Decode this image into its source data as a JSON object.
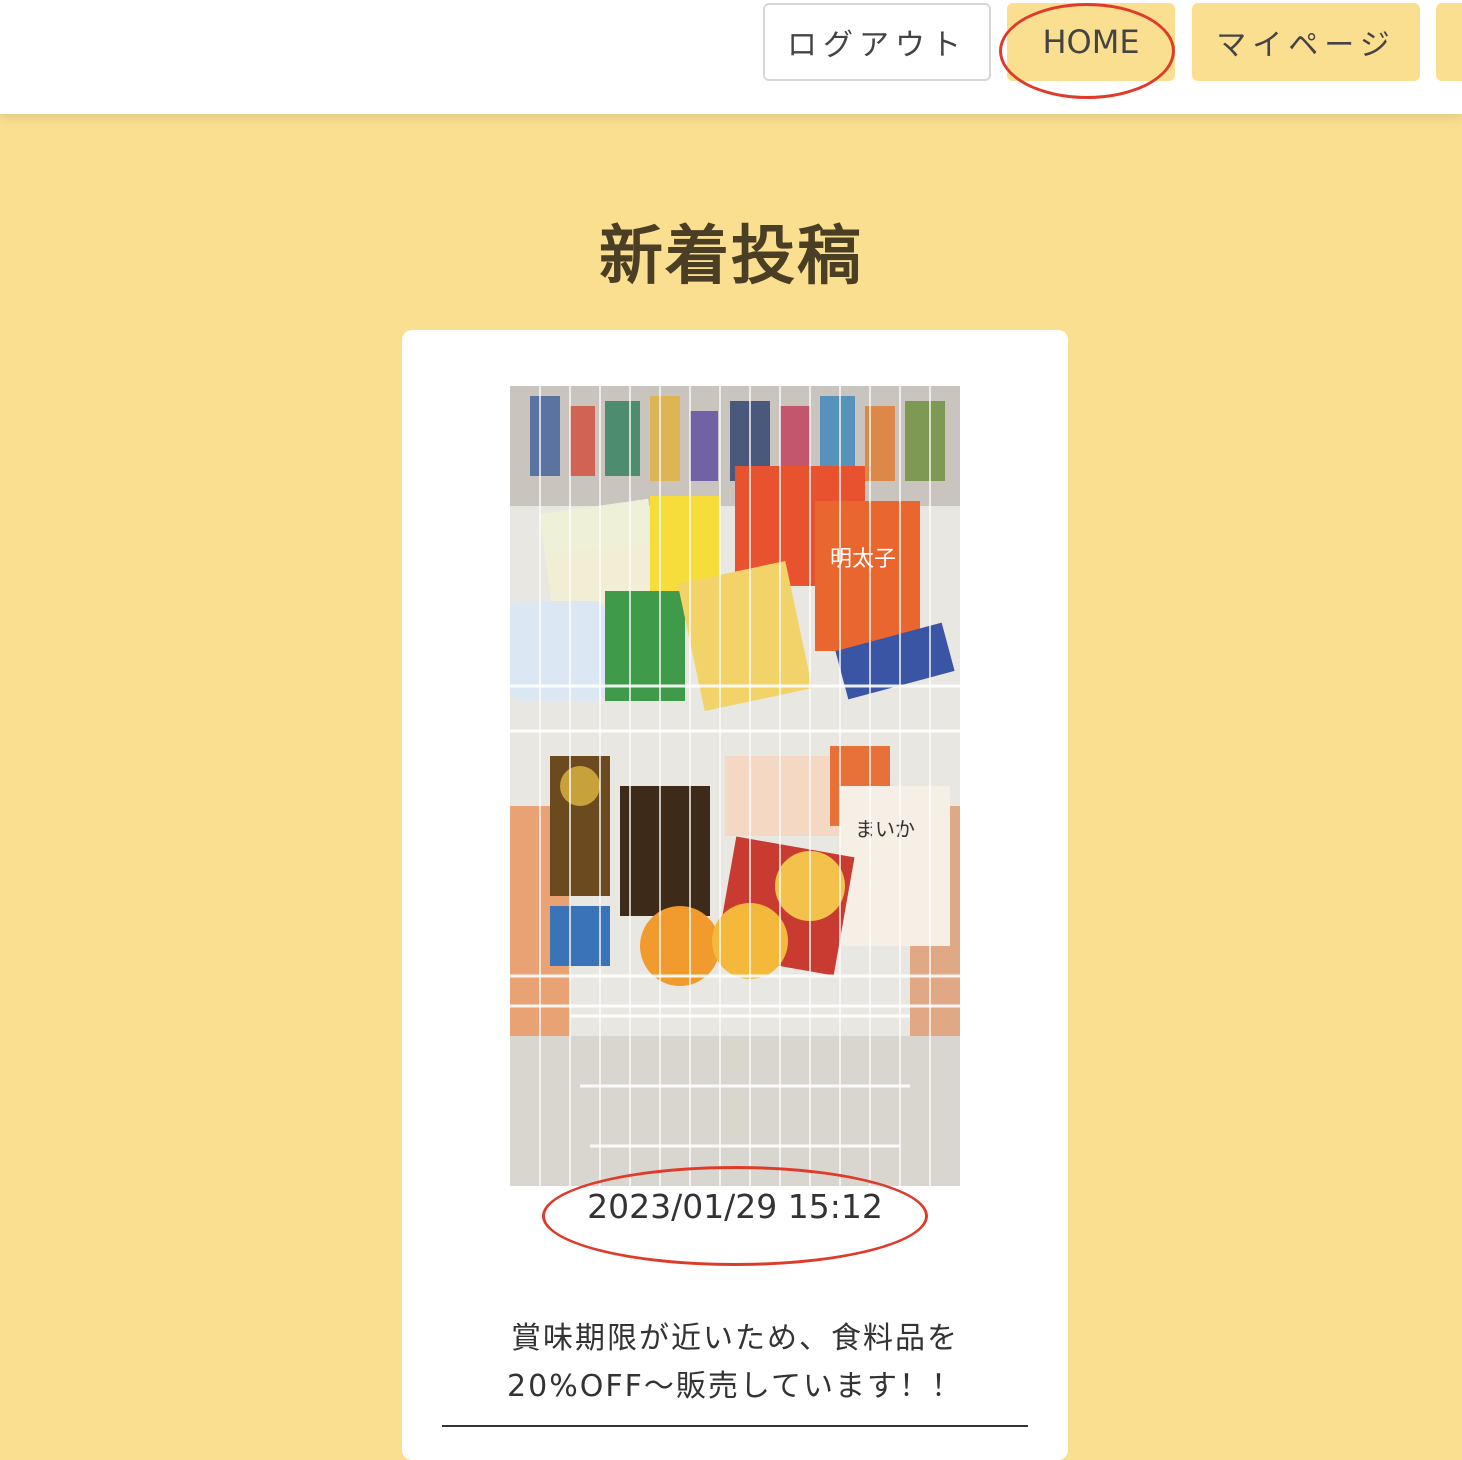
{
  "nav": {
    "logout_label": "ログアウト",
    "home_label": "HOME",
    "mypage_label": "マイページ"
  },
  "main": {
    "heading": "新着投稿"
  },
  "post": {
    "image_alt": "買い物カートに入った割引食料品",
    "datetime": "2023/01/29 15:12",
    "description_line1": "賞味期限が近いため、食料品を",
    "description_line2": "20%OFF〜販売しています！！"
  },
  "colors": {
    "accent": "#fbdf91",
    "annotation": "#de3b2a",
    "heading": "#4a3f25"
  }
}
